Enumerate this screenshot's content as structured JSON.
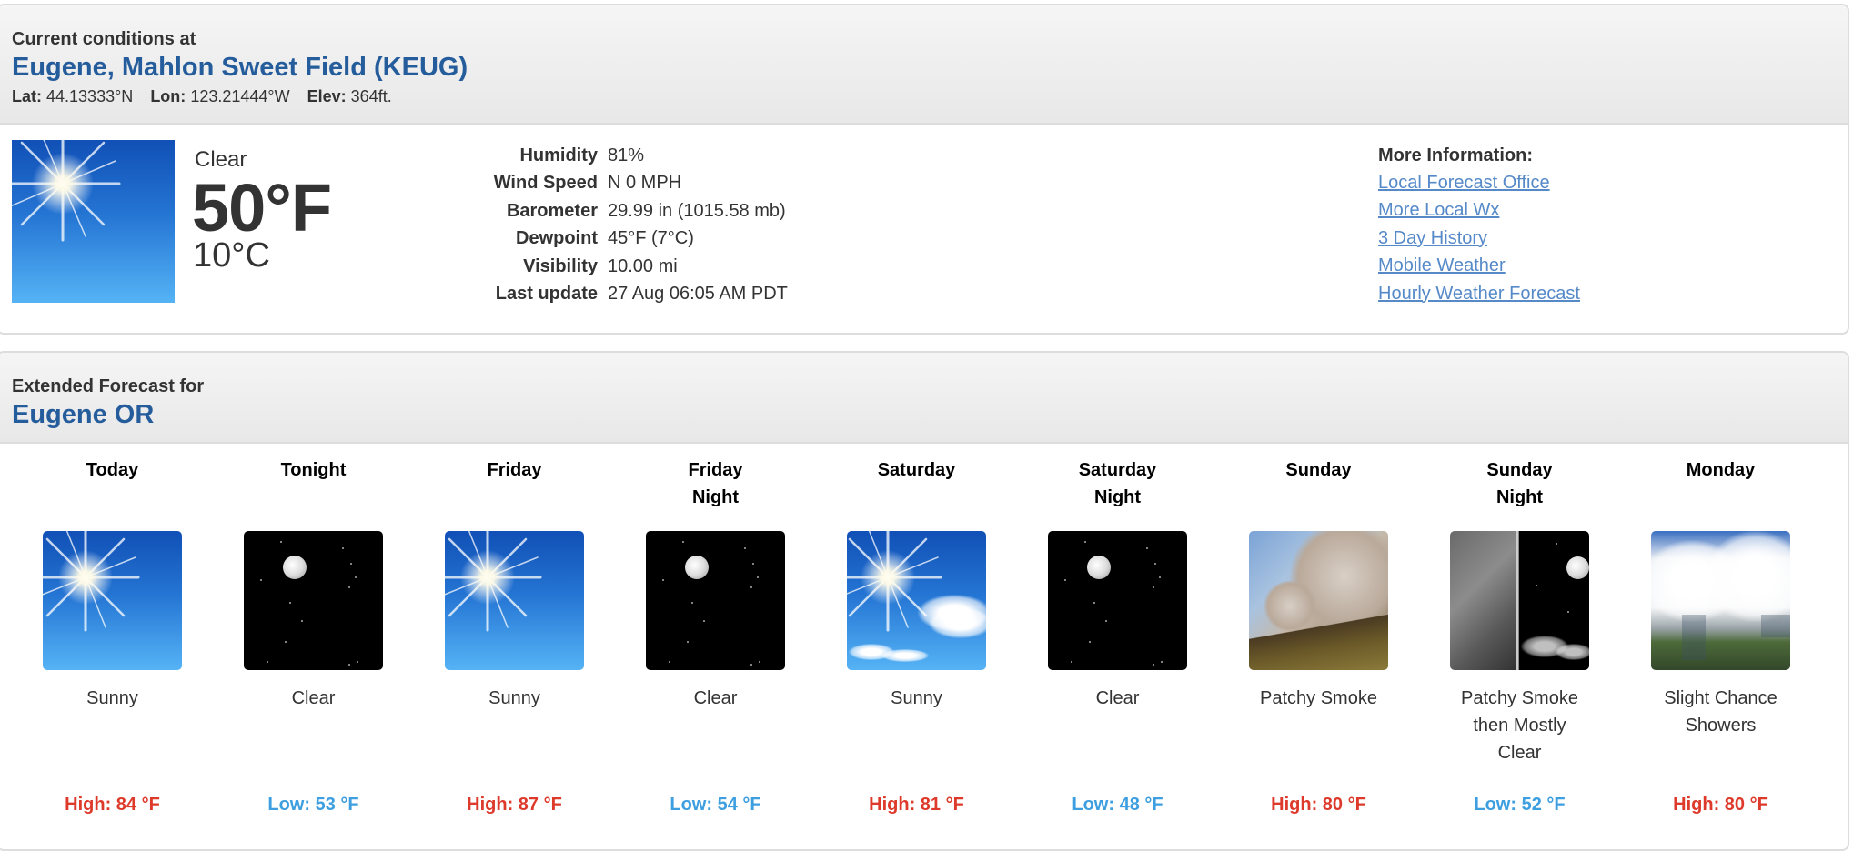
{
  "current": {
    "header_small": "Current conditions at",
    "station_name": "Eugene, Mahlon Sweet Field (KEUG)",
    "lat_label": "Lat:",
    "lat_value": "44.13333°N",
    "lon_label": "Lon:",
    "lon_value": "123.21444°W",
    "elev_label": "Elev:",
    "elev_value": "364ft.",
    "icon": "clear-sun-icon",
    "condition": "Clear",
    "temp_f": "50°F",
    "temp_c": "10°C",
    "details": [
      {
        "label": "Humidity",
        "value": "81%"
      },
      {
        "label": "Wind Speed",
        "value": "N 0 MPH"
      },
      {
        "label": "Barometer",
        "value": "29.99 in (1015.58 mb)"
      },
      {
        "label": "Dewpoint",
        "value": "45°F (7°C)"
      },
      {
        "label": "Visibility",
        "value": "10.00 mi"
      },
      {
        "label": "Last update",
        "value": "27 Aug 06:05 AM PDT"
      }
    ],
    "more_info": {
      "title": "More Information:",
      "links": [
        "Local Forecast Office",
        "More Local Wx",
        "3 Day History",
        "Mobile Weather",
        "Hourly Weather Forecast"
      ]
    }
  },
  "forecast": {
    "header_small": "Extended Forecast for",
    "location": "Eugene OR",
    "periods": [
      {
        "name_line1": "Today",
        "name_line2": "",
        "icon": "sunny-icon",
        "short1": "Sunny",
        "short2": "",
        "short3": "",
        "temp": "High: 84 °F",
        "temp_type": "high"
      },
      {
        "name_line1": "Tonight",
        "name_line2": "",
        "icon": "clear-night-icon",
        "short1": "Clear",
        "short2": "",
        "short3": "",
        "temp": "Low: 53 °F",
        "temp_type": "low"
      },
      {
        "name_line1": "Friday",
        "name_line2": "",
        "icon": "sunny-icon",
        "short1": "Sunny",
        "short2": "",
        "short3": "",
        "temp": "High: 87 °F",
        "temp_type": "high"
      },
      {
        "name_line1": "Friday",
        "name_line2": "Night",
        "icon": "clear-night-icon",
        "short1": "Clear",
        "short2": "",
        "short3": "",
        "temp": "Low: 54 °F",
        "temp_type": "low"
      },
      {
        "name_line1": "Saturday",
        "name_line2": "",
        "icon": "sunny-few-clouds-icon",
        "short1": "Sunny",
        "short2": "",
        "short3": "",
        "temp": "High: 81 °F",
        "temp_type": "high"
      },
      {
        "name_line1": "Saturday",
        "name_line2": "Night",
        "icon": "clear-night-icon",
        "short1": "Clear",
        "short2": "",
        "short3": "",
        "temp": "Low: 48 °F",
        "temp_type": "low"
      },
      {
        "name_line1": "Sunday",
        "name_line2": "",
        "icon": "patchy-smoke-icon",
        "short1": "Patchy Smoke",
        "short2": "",
        "short3": "",
        "temp": "High: 80 °F",
        "temp_type": "high"
      },
      {
        "name_line1": "Sunday",
        "name_line2": "Night",
        "icon": "smoke-then-mostly-clear-icon",
        "short1": "Patchy Smoke",
        "short2": "then Mostly",
        "short3": "Clear",
        "temp": "Low: 52 °F",
        "temp_type": "low"
      },
      {
        "name_line1": "Monday",
        "name_line2": "",
        "icon": "slight-chance-showers-icon",
        "short1": "Slight Chance",
        "short2": "Showers",
        "short3": "",
        "temp": "High: 80 °F",
        "temp_type": "high"
      }
    ]
  },
  "colors": {
    "title_blue": "#255d9c",
    "link_blue": "#5589c8",
    "high_red": "#dd3a2b",
    "low_blue": "#3d9ee0"
  }
}
